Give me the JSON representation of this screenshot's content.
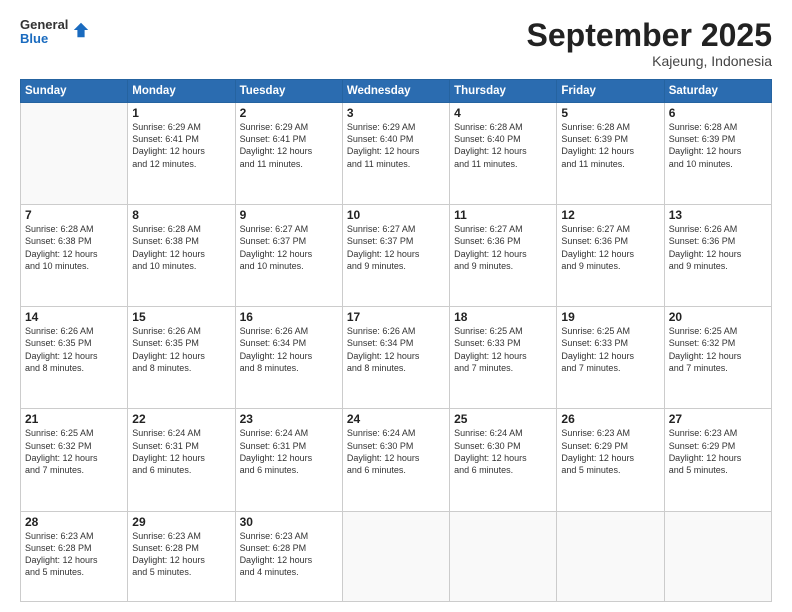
{
  "logo": {
    "general": "General",
    "blue": "Blue"
  },
  "header": {
    "month": "September 2025",
    "location": "Kajeung, Indonesia"
  },
  "days_of_week": [
    "Sunday",
    "Monday",
    "Tuesday",
    "Wednesday",
    "Thursday",
    "Friday",
    "Saturday"
  ],
  "weeks": [
    [
      {
        "day": "",
        "info": ""
      },
      {
        "day": "1",
        "info": "Sunrise: 6:29 AM\nSunset: 6:41 PM\nDaylight: 12 hours\nand 12 minutes."
      },
      {
        "day": "2",
        "info": "Sunrise: 6:29 AM\nSunset: 6:41 PM\nDaylight: 12 hours\nand 11 minutes."
      },
      {
        "day": "3",
        "info": "Sunrise: 6:29 AM\nSunset: 6:40 PM\nDaylight: 12 hours\nand 11 minutes."
      },
      {
        "day": "4",
        "info": "Sunrise: 6:28 AM\nSunset: 6:40 PM\nDaylight: 12 hours\nand 11 minutes."
      },
      {
        "day": "5",
        "info": "Sunrise: 6:28 AM\nSunset: 6:39 PM\nDaylight: 12 hours\nand 11 minutes."
      },
      {
        "day": "6",
        "info": "Sunrise: 6:28 AM\nSunset: 6:39 PM\nDaylight: 12 hours\nand 10 minutes."
      }
    ],
    [
      {
        "day": "7",
        "info": "Sunrise: 6:28 AM\nSunset: 6:38 PM\nDaylight: 12 hours\nand 10 minutes."
      },
      {
        "day": "8",
        "info": "Sunrise: 6:28 AM\nSunset: 6:38 PM\nDaylight: 12 hours\nand 10 minutes."
      },
      {
        "day": "9",
        "info": "Sunrise: 6:27 AM\nSunset: 6:37 PM\nDaylight: 12 hours\nand 10 minutes."
      },
      {
        "day": "10",
        "info": "Sunrise: 6:27 AM\nSunset: 6:37 PM\nDaylight: 12 hours\nand 9 minutes."
      },
      {
        "day": "11",
        "info": "Sunrise: 6:27 AM\nSunset: 6:36 PM\nDaylight: 12 hours\nand 9 minutes."
      },
      {
        "day": "12",
        "info": "Sunrise: 6:27 AM\nSunset: 6:36 PM\nDaylight: 12 hours\nand 9 minutes."
      },
      {
        "day": "13",
        "info": "Sunrise: 6:26 AM\nSunset: 6:36 PM\nDaylight: 12 hours\nand 9 minutes."
      }
    ],
    [
      {
        "day": "14",
        "info": "Sunrise: 6:26 AM\nSunset: 6:35 PM\nDaylight: 12 hours\nand 8 minutes."
      },
      {
        "day": "15",
        "info": "Sunrise: 6:26 AM\nSunset: 6:35 PM\nDaylight: 12 hours\nand 8 minutes."
      },
      {
        "day": "16",
        "info": "Sunrise: 6:26 AM\nSunset: 6:34 PM\nDaylight: 12 hours\nand 8 minutes."
      },
      {
        "day": "17",
        "info": "Sunrise: 6:26 AM\nSunset: 6:34 PM\nDaylight: 12 hours\nand 8 minutes."
      },
      {
        "day": "18",
        "info": "Sunrise: 6:25 AM\nSunset: 6:33 PM\nDaylight: 12 hours\nand 7 minutes."
      },
      {
        "day": "19",
        "info": "Sunrise: 6:25 AM\nSunset: 6:33 PM\nDaylight: 12 hours\nand 7 minutes."
      },
      {
        "day": "20",
        "info": "Sunrise: 6:25 AM\nSunset: 6:32 PM\nDaylight: 12 hours\nand 7 minutes."
      }
    ],
    [
      {
        "day": "21",
        "info": "Sunrise: 6:25 AM\nSunset: 6:32 PM\nDaylight: 12 hours\nand 7 minutes."
      },
      {
        "day": "22",
        "info": "Sunrise: 6:24 AM\nSunset: 6:31 PM\nDaylight: 12 hours\nand 6 minutes."
      },
      {
        "day": "23",
        "info": "Sunrise: 6:24 AM\nSunset: 6:31 PM\nDaylight: 12 hours\nand 6 minutes."
      },
      {
        "day": "24",
        "info": "Sunrise: 6:24 AM\nSunset: 6:30 PM\nDaylight: 12 hours\nand 6 minutes."
      },
      {
        "day": "25",
        "info": "Sunrise: 6:24 AM\nSunset: 6:30 PM\nDaylight: 12 hours\nand 6 minutes."
      },
      {
        "day": "26",
        "info": "Sunrise: 6:23 AM\nSunset: 6:29 PM\nDaylight: 12 hours\nand 5 minutes."
      },
      {
        "day": "27",
        "info": "Sunrise: 6:23 AM\nSunset: 6:29 PM\nDaylight: 12 hours\nand 5 minutes."
      }
    ],
    [
      {
        "day": "28",
        "info": "Sunrise: 6:23 AM\nSunset: 6:28 PM\nDaylight: 12 hours\nand 5 minutes."
      },
      {
        "day": "29",
        "info": "Sunrise: 6:23 AM\nSunset: 6:28 PM\nDaylight: 12 hours\nand 5 minutes."
      },
      {
        "day": "30",
        "info": "Sunrise: 6:23 AM\nSunset: 6:28 PM\nDaylight: 12 hours\nand 4 minutes."
      },
      {
        "day": "",
        "info": ""
      },
      {
        "day": "",
        "info": ""
      },
      {
        "day": "",
        "info": ""
      },
      {
        "day": "",
        "info": ""
      }
    ]
  ]
}
